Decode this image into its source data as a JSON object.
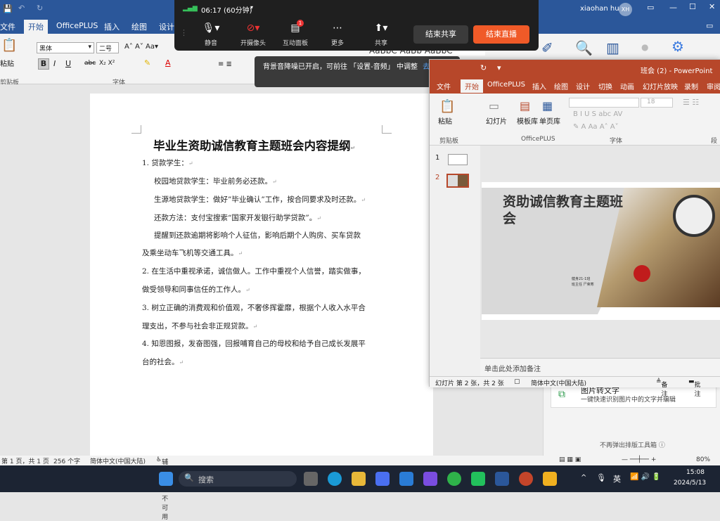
{
  "word": {
    "title_user": "xiaohan hu",
    "avatar": "XH",
    "tabs": [
      "文件",
      "开始",
      "OfficePLUS",
      "插入",
      "绘图",
      "设计"
    ],
    "ribbon": {
      "paste": "粘贴",
      "clipboard": "剪贴板",
      "font_name": "黑体",
      "font_size": "二号",
      "font_group": "字体",
      "style_sample": "AaBbC AaBb AaBbC"
    },
    "doc": {
      "title": "毕业生资助诚信教育主题班会内容提纲",
      "lines": [
        "1. 贷款学生：",
        "校园地贷款学生：毕业前务必还款。",
        "生源地贷款学生：做好”毕业确认”工作，按合同要求及时还款。",
        "还款方法：支付宝搜索“国家开发银行助学贷款”。",
        "提醒到还款逾期将影响个人征信，影响后期个人购房、买车贷款",
        "及乘坐动车飞机等交通工具。",
        "2. 在生活中重视承诺，诚信做人。工作中重视个人信誉，踏实做事，",
        "做受领导和同事信任的工作人。",
        "3. 树立正确的消费观和价值观，不奢侈挥霍靡，根据个人收入水平合",
        "理支出，不参与社会非正规贷款。",
        "4. 知恩图报，发奋图强，回报哺育自己的母校和给予自己成长发展平",
        "台的社会。"
      ]
    },
    "side_panel": {
      "item_title": "图片转文字",
      "item_desc": "一键快速识别图片中的文字并编辑",
      "footer": "不再弹出排版工具箱"
    },
    "status": {
      "page": "第 1 页，共 1 页",
      "words": "256 个字",
      "lang": "简体中文(中国大陆)",
      "access": "辅助功能: 不可用",
      "zoom": "80%"
    }
  },
  "zoom_bar": {
    "timer": "06:17 (60分钟)",
    "buttons": [
      "静音",
      "开摄像头",
      "互动面板",
      "更多",
      "共享"
    ],
    "badge": "1",
    "end_share": "结束共享",
    "end_live": "结束直播",
    "toast": "背景音降噪已开启，可前往 「设置-音频」 中调整",
    "toast_link": "去设置"
  },
  "ppt": {
    "title": "班会 (2) - PowerPoint",
    "tabs": [
      "文件",
      "开始",
      "OfficePLUS",
      "插入",
      "绘图",
      "设计",
      "切换",
      "动画",
      "幻灯片放映",
      "录制",
      "审阅"
    ],
    "ribbon": {
      "paste": "粘贴",
      "clipboard": "剪贴板",
      "slides": "幻灯片",
      "template": "模板库",
      "single": "单页库",
      "officeplus": "OfficePLUS",
      "font": "字体",
      "font_size": "18",
      "para": "段落"
    },
    "thumbs": [
      "1",
      "2"
    ],
    "slide": {
      "title": "资助诚信教育主题班会",
      "sub1": "健身21-1班",
      "sub2": "班主任 尸荣寒"
    },
    "notes": "单击此处添加备注",
    "status": {
      "slide": "幻灯片 第 2 张，共 2 张",
      "lang": "简体中文(中国大陆)",
      "notes": "备注",
      "comments": "批注"
    }
  },
  "taskbar": {
    "search": "搜索",
    "ime": "英",
    "time": "15:08",
    "date": "2024/5/13"
  },
  "colors": {
    "word": "#2b579a",
    "ppt": "#b7472a",
    "live": "#f05a28"
  }
}
